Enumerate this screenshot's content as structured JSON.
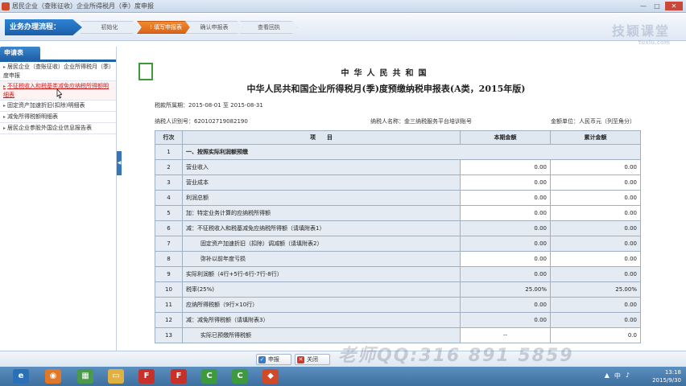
{
  "window": {
    "title": "居民企业（查账征收）企业所得税月（季）度申报"
  },
  "process": {
    "label": "业务办理流程：",
    "steps": [
      {
        "label": "初始化"
      },
      {
        "label": "! 填写申报表"
      },
      {
        "label": "确认申报表"
      },
      {
        "label": "查看回执"
      }
    ]
  },
  "watermark_top": {
    "text": "技颖课堂",
    "sub": "tuxiu.com"
  },
  "sidebar": {
    "tab": "申请表",
    "items": [
      {
        "label": "居民企业（查账征收）企业所得税月（季）度申报"
      },
      {
        "label": "不征税收入和税基类减免应纳税所得额明细表"
      },
      {
        "label": "固定资产加速折旧(扣除)明细表"
      },
      {
        "label": "减免所得税额明细表"
      },
      {
        "label": "居民企业参股外国企业信息报告表"
      }
    ]
  },
  "form": {
    "title1": "中华人民共和国",
    "title2": "中华人民共和国企业所得税月(季)度预缴纳税申报表(A类，2015年版)",
    "period": "税款所属期：2015-08-01 至 2015-08-31",
    "taxpayer_id": "纳税人识别号：620102719082190",
    "taxpayer_name": "纳税人名称：金三纳税服务平台培训账号",
    "unit": "金额单位：人民币元（列至角分）",
    "headers": {
      "no": "行次",
      "item": "项　　目",
      "current": "本期金额",
      "cumulative": "累计金额"
    },
    "rows": [
      {
        "no": "1",
        "item": "一、按照实际利润额预缴",
        "current": "",
        "cumulative": ""
      },
      {
        "no": "2",
        "item": "营业收入",
        "current": "0.00",
        "cumulative": "0.00"
      },
      {
        "no": "3",
        "item": "营业成本",
        "current": "0.00",
        "cumulative": "0.00"
      },
      {
        "no": "4",
        "item": "利润总额",
        "current": "0.00",
        "cumulative": "0.00"
      },
      {
        "no": "5",
        "item": "加：特定业务计算的应纳税所得额",
        "current": "0.00",
        "cumulative": "0.00"
      },
      {
        "no": "6",
        "item": "减：不征税收入和税基减免应纳税所得额（请填附表1）",
        "current": "0.00",
        "cumulative": "0.00"
      },
      {
        "no": "7",
        "item": "固定资产加速折旧（扣除）调减额（请填附表2）",
        "current": "0.00",
        "cumulative": "0.00"
      },
      {
        "no": "8",
        "item": "弥补以前年度亏损",
        "current": "0.00",
        "cumulative": "0.00"
      },
      {
        "no": "9",
        "item": "实际利润额（4行+5行-6行-7行-8行）",
        "current": "0.00",
        "cumulative": "0.00"
      },
      {
        "no": "10",
        "item": "税率(25%)",
        "current": "25.00%",
        "cumulative": "25.00%"
      },
      {
        "no": "11",
        "item": "应纳所得税额（9行×10行）",
        "current": "0.00",
        "cumulative": "0.00"
      },
      {
        "no": "12",
        "item": "减：减免所得税额（请填附表3）",
        "current": "0.00",
        "cumulative": "0.00"
      },
      {
        "no": "13",
        "item": "实际已预缴所得税额",
        "current": "--",
        "cumulative": "0.0"
      }
    ]
  },
  "buttons": {
    "submit": "申报",
    "close": "关闭"
  },
  "watermark_bottom": "老师QQ:316 891 5859",
  "taskbar": {
    "time": "13:18",
    "date": "2015/9/30",
    "ime": "中"
  }
}
